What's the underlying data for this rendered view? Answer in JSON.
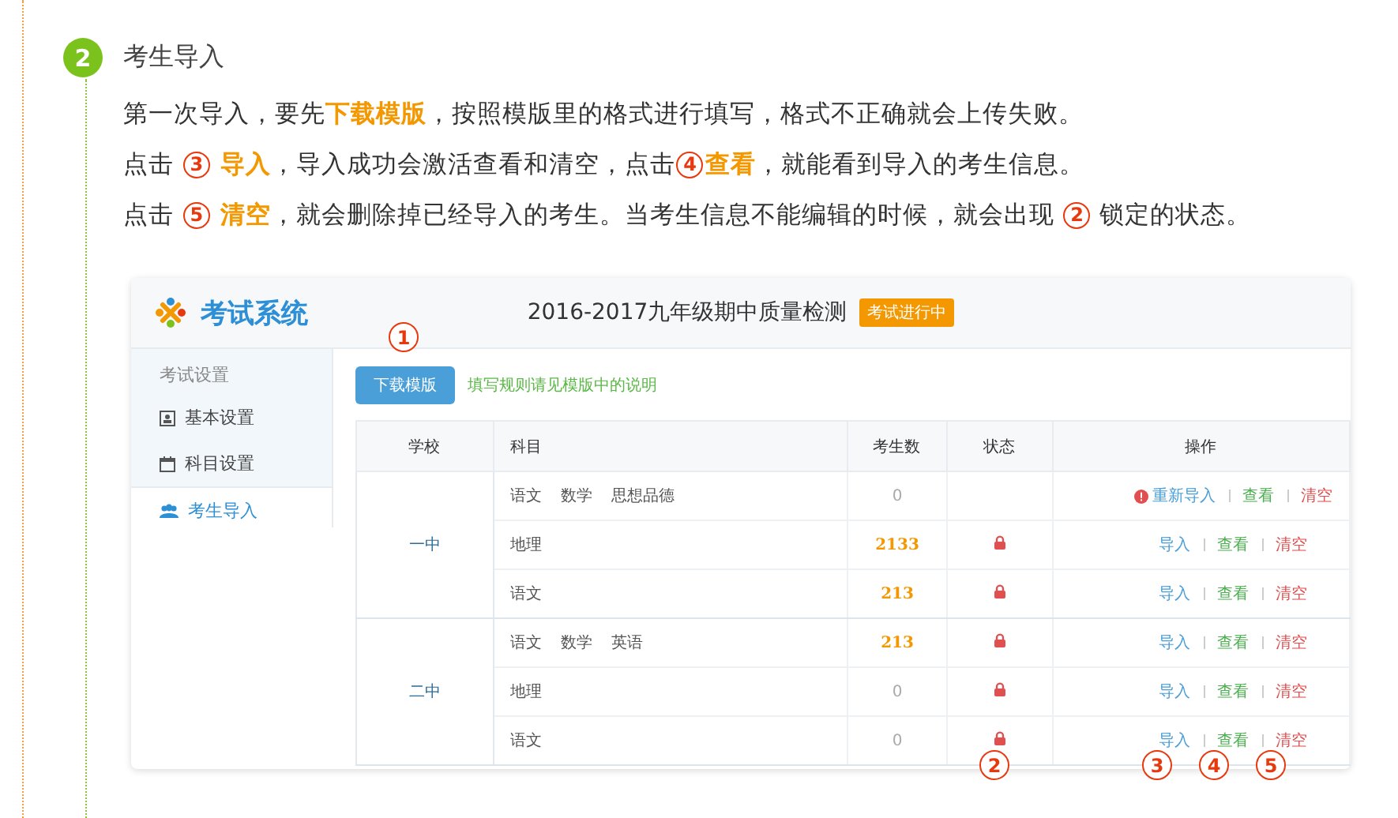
{
  "step": {
    "number": "2",
    "title": "考生导入"
  },
  "paragraphs": [
    [
      {
        "kind": "plain",
        "text": "第一次导入，要先"
      },
      {
        "kind": "highlight",
        "text": "下载模版"
      },
      {
        "kind": "plain",
        "text": "，按照模版里的格式进行填写，格式不正确就会上传失败。"
      }
    ],
    [
      {
        "kind": "plain",
        "text": "点击 "
      },
      {
        "kind": "marker",
        "text": "3"
      },
      {
        "kind": "highlight",
        "text": " 导入"
      },
      {
        "kind": "plain",
        "text": "，导入成功会激活查看和清空，点击"
      },
      {
        "kind": "marker",
        "text": "4"
      },
      {
        "kind": "highlight",
        "text": "查看"
      },
      {
        "kind": "plain",
        "text": "，就能看到导入的考生信息。"
      }
    ],
    [
      {
        "kind": "plain",
        "text": "点击 "
      },
      {
        "kind": "marker",
        "text": "5"
      },
      {
        "kind": "highlight",
        "text": " 清空"
      },
      {
        "kind": "plain",
        "text": "，就会删除掉已经导入的考生。当考生信息不能编辑的时候，就会出现 "
      },
      {
        "kind": "marker",
        "text": "2"
      },
      {
        "kind": "plain",
        "text": " 锁定的状态。"
      }
    ]
  ],
  "app": {
    "brand": "考试系统",
    "exam_title": "2016-2017九年级期中质量检测",
    "exam_status": "考试进行中",
    "sidebar": {
      "heading": "考试设置",
      "items": [
        {
          "label": "基本设置",
          "selected": false
        },
        {
          "label": "科目设置",
          "selected": false
        },
        {
          "label": "考生导入",
          "selected": true
        }
      ]
    },
    "download_button": "下载模版",
    "hint": "填写规则请见模版中的说明",
    "columns": [
      "学校",
      "科目",
      "考生数",
      "状态",
      "操作"
    ],
    "schools": [
      {
        "name": "一中",
        "rows": [
          {
            "subjects": [
              "语文",
              "数学",
              "思想品德"
            ],
            "count": "0",
            "imported": false,
            "locked": false,
            "import_error": true,
            "actions": [
              {
                "kind": "import",
                "label": "重新导入"
              },
              {
                "kind": "view",
                "label": "查看"
              },
              {
                "kind": "clear",
                "label": "清空"
              }
            ]
          },
          {
            "subjects": [
              "地理"
            ],
            "count": "2133",
            "imported": true,
            "locked": true,
            "import_error": false,
            "actions": [
              {
                "kind": "import",
                "label": "导入"
              },
              {
                "kind": "view",
                "label": "查看"
              },
              {
                "kind": "clear",
                "label": "清空"
              }
            ]
          },
          {
            "subjects": [
              "语文"
            ],
            "count": "213",
            "imported": true,
            "locked": true,
            "import_error": false,
            "actions": [
              {
                "kind": "import",
                "label": "导入"
              },
              {
                "kind": "view",
                "label": "查看"
              },
              {
                "kind": "clear",
                "label": "清空"
              }
            ]
          }
        ]
      },
      {
        "name": "二中",
        "rows": [
          {
            "subjects": [
              "语文",
              "数学",
              "英语"
            ],
            "count": "213",
            "imported": true,
            "locked": true,
            "import_error": false,
            "actions": [
              {
                "kind": "import",
                "label": "导入"
              },
              {
                "kind": "view",
                "label": "查看"
              },
              {
                "kind": "clear",
                "label": "清空"
              }
            ]
          },
          {
            "subjects": [
              "地理"
            ],
            "count": "0",
            "imported": false,
            "locked": true,
            "import_error": false,
            "actions": [
              {
                "kind": "import",
                "label": "导入"
              },
              {
                "kind": "view",
                "label": "查看"
              },
              {
                "kind": "clear",
                "label": "清空"
              }
            ]
          },
          {
            "subjects": [
              "语文"
            ],
            "count": "0",
            "imported": false,
            "locked": true,
            "import_error": false,
            "actions": [
              {
                "kind": "import",
                "label": "导入"
              },
              {
                "kind": "view",
                "label": "查看"
              },
              {
                "kind": "clear",
                "label": "清空"
              }
            ]
          }
        ]
      }
    ]
  },
  "callouts": [
    "1",
    "2",
    "3",
    "4",
    "5"
  ]
}
